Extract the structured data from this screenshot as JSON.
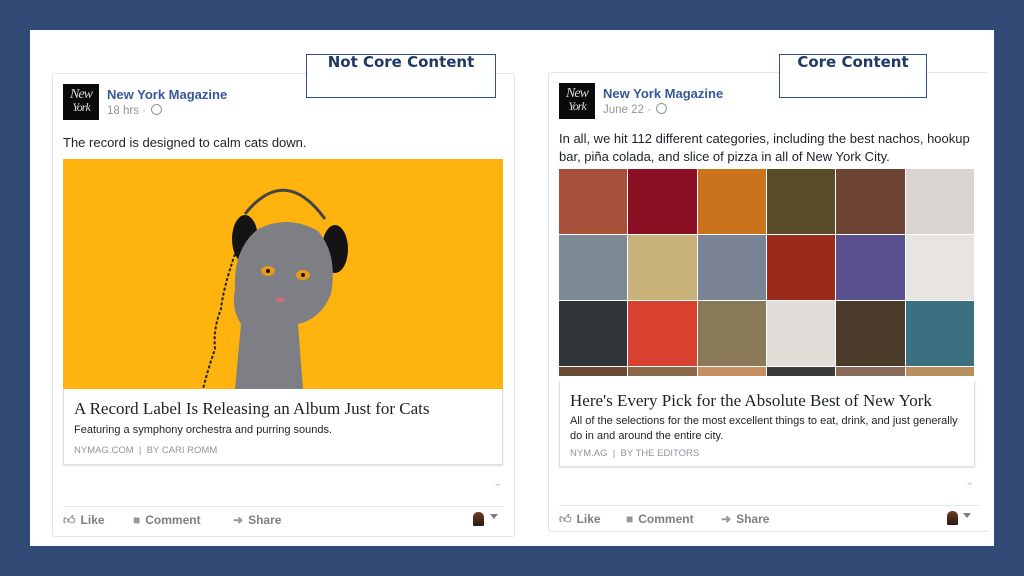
{
  "labels": {
    "left": "Not Core Content",
    "right": "Core Content"
  },
  "posts": [
    {
      "page_name": "New York Magazine",
      "logo_text": [
        "New",
        "York"
      ],
      "time": "18 hrs",
      "separator": "·",
      "privacy_icon": "globe-icon",
      "text": "The record is designed to calm cats down.",
      "media": "cat-with-headphones-image",
      "media_bg": "#ffb30f",
      "link": {
        "title": "A Record Label Is Releasing an Album Just for Cats",
        "description": "Featuring a symphony orchestra and purring sounds.",
        "source": "NYMAG.COM",
        "byline": "BY CARI ROMM"
      },
      "actions": [
        "Like",
        "Comment",
        "Share"
      ]
    },
    {
      "page_name": "New York Magazine",
      "logo_text": [
        "New",
        "York"
      ],
      "time": "June 22",
      "separator": "·",
      "privacy_icon": "globe-icon",
      "text": "In all, we hit 112 different categories, including the best nachos, hookup bar, piña colada, and slice of pizza in all of New York City.",
      "media": "food-and-nightlife-photo-grid",
      "grid_colors": [
        "#a8503a",
        "#8c1024",
        "#c9741d",
        "#5a4c2a",
        "#6e4434",
        "#d8d4d0",
        "#7c8a94",
        "#c8b27a",
        "#7a8494",
        "#9a2a1a",
        "#5a5090",
        "#e8e4e0",
        "#303438",
        "#d84030",
        "#8a7a5a",
        "#e0dcd8",
        "#4a3a2a",
        "#3a7080",
        "#6a4a30",
        "#8a6a4a",
        "#c89060",
        "#3a3a3a",
        "#8a6a5a",
        "#b89060"
      ],
      "link": {
        "title": "Here's Every Pick for the Absolute Best of New York",
        "description": "All of the selections for the most excellent things to eat, drink, and just generally do in and around the entire city.",
        "source": "NYM.AG",
        "byline": "BY THE EDITORS"
      },
      "actions": [
        "Like",
        "Comment",
        "Share"
      ]
    }
  ],
  "colors": {
    "background": "#314b76",
    "page_name": "#365899",
    "label_text": "#1f3864"
  }
}
